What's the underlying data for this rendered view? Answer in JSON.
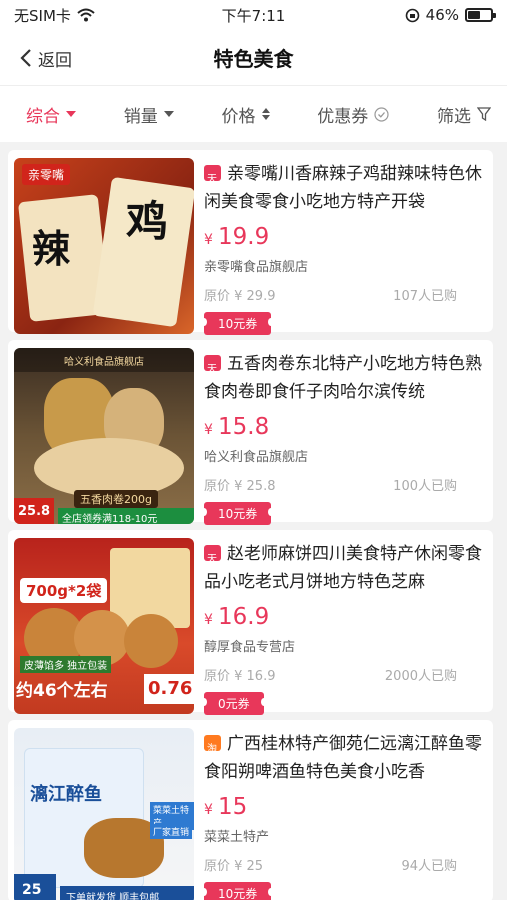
{
  "status": {
    "carrier": "无SIM卡",
    "time": "下午7:11",
    "battery": "46%"
  },
  "nav": {
    "back_label": "返回",
    "title": "特色美食"
  },
  "filters": {
    "comprehensive": "综合",
    "sales": "销量",
    "price": "价格",
    "coupon": "优惠券",
    "filter": "筛选"
  },
  "products": [
    {
      "title": "亲零嘴川香麻辣子鸡甜辣味特色休闲美食零食小吃地方特产开袋",
      "price": "19.9",
      "shop": "亲零嘴食品旗舰店",
      "original": "原价 ¥ 29.9",
      "sold": "107人已购",
      "coupon": "10元券",
      "badge": "tmall",
      "img_text": [
        "亲零嘴",
        "鸡",
        "辣"
      ]
    },
    {
      "title": "五香肉卷东北特产小吃地方特色熟食肉卷即食仟子肉哈尔滨传统",
      "price": "15.8",
      "shop": "哈义利食品旗舰店",
      "original": "原价 ¥ 25.8",
      "sold": "100人已购",
      "coupon": "10元券",
      "badge": "tmall",
      "img_text": [
        "哈义利食品旗舰店",
        "五香肉卷200g",
        "25.8",
        "全店领券满118-10元"
      ]
    },
    {
      "title": "赵老师麻饼四川美食特产休闲零食品小吃老式月饼地方特色芝麻",
      "price": "16.9",
      "shop": "醇厚食品专营店",
      "original": "原价 ¥ 16.9",
      "sold": "2000人已购",
      "coupon": "0元券",
      "badge": "tmall",
      "img_text": [
        "700g*2袋",
        "皮薄馅多 独立包装",
        "约46个左右",
        "0.76"
      ]
    },
    {
      "title": "广西桂林特产御苑仁远漓江醉鱼零食阳朔啤酒鱼特色美食小吃香",
      "price": "15",
      "shop": "菜菜土特产",
      "original": "原价 ¥ 25",
      "sold": "94人已购",
      "coupon": "10元券",
      "badge": "taobao",
      "img_text": [
        "漓江醉鱼",
        "菜菜土特产",
        "厂家直销",
        "25",
        "下单就发货 顺丰包邮"
      ]
    }
  ],
  "colors": {
    "accent": "#e8375a",
    "taobao": "#ff7a20"
  }
}
